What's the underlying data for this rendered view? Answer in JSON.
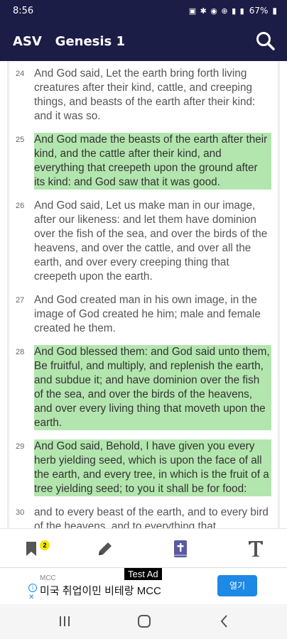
{
  "status": {
    "time": "8:56",
    "battery": "67%",
    "icons": "▣ ✱ ◉ ⊕ ▮ ▮"
  },
  "header": {
    "version": "ASV",
    "book_chapter": "Genesis 1"
  },
  "verses": [
    {
      "num": "24",
      "text": "And God said, Let the earth bring forth living creatures after their kind, cattle, and creeping things, and beasts of the earth after their kind: and it was so.",
      "highlighted": false
    },
    {
      "num": "25",
      "text": "And God made the beasts of the earth after their kind, and the cattle after their kind, and everything that creepeth upon the ground after its kind: and God saw that it was good.",
      "highlighted": true
    },
    {
      "num": "26",
      "text": "And God said, Let us make man in our image, after our likeness: and let them have dominion over the fish of the sea, and over the birds of the heavens, and over the cattle, and over all the earth, and over every creeping thing that creepeth upon the earth.",
      "highlighted": false
    },
    {
      "num": "27",
      "text": "And God created man in his own image, in the image of God created he him; male and female created he them.",
      "highlighted": false
    },
    {
      "num": "28",
      "text": "And God blessed them: and God said unto them, Be fruitful, and multiply, and replenish the earth, and subdue it; and have dominion over the fish of the sea, and over the birds of the heavens, and over every living thing that moveth upon the earth.",
      "highlighted": true
    },
    {
      "num": "29",
      "text": "And God said, Behold, I have given you every herb yielding seed, which is upon the face of all the earth, and every tree, in which is the fruit of a tree yielding seed; to you it shall be for food:",
      "highlighted": true
    },
    {
      "num": "30",
      "text": "and to every beast of the earth, and to every bird of the heavens, and to everything that",
      "highlighted": false
    }
  ],
  "toolbar": {
    "bookmark_badge": "2"
  },
  "ad": {
    "label": "Test Ad",
    "company": "MCC",
    "text": "미국 취업이민 비테랑 MCC",
    "cta": "열기"
  },
  "colors": {
    "header_bg": "#1b1d47",
    "highlight": "#b3e6ae",
    "icon_purple": "#5b5aa0",
    "ad_blue": "#1e88e5"
  }
}
